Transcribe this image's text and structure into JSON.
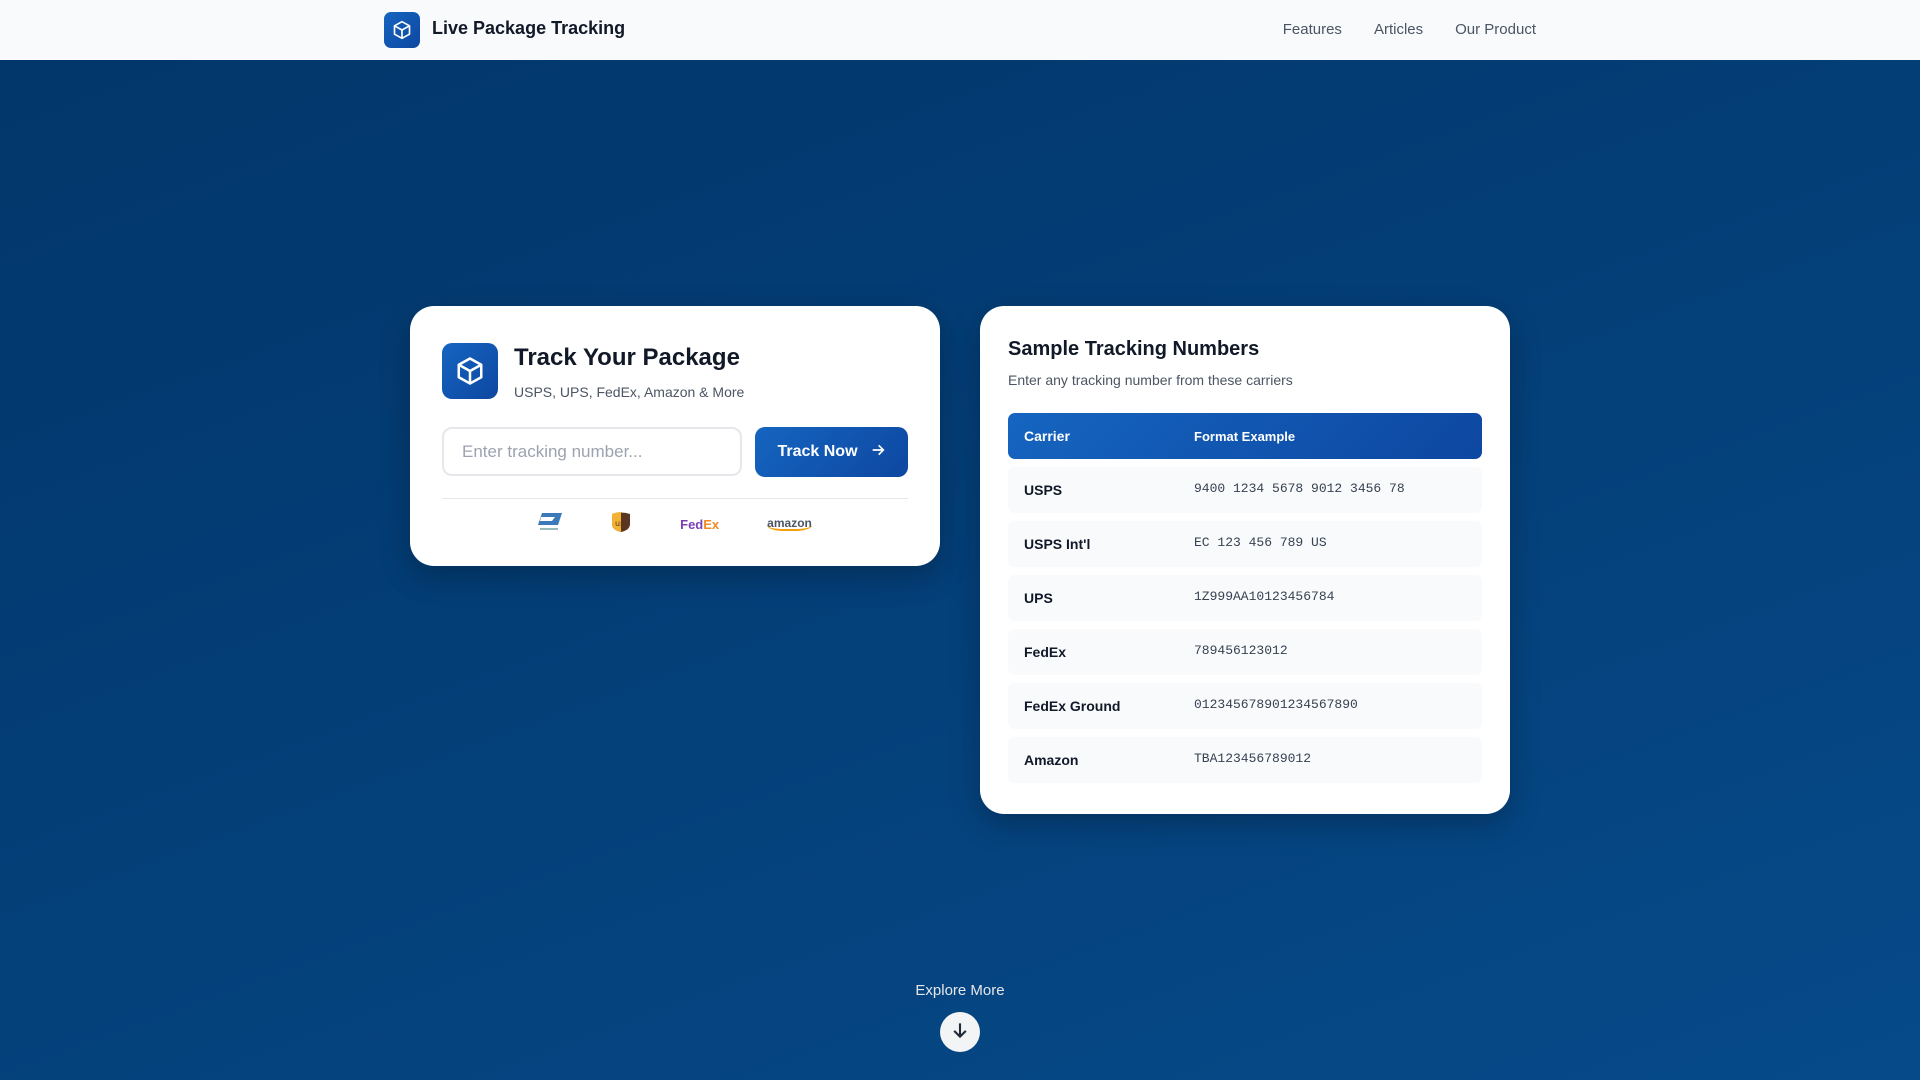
{
  "header": {
    "title": "Live Package Tracking",
    "nav": [
      "Features",
      "Articles",
      "Our Product"
    ]
  },
  "tracker": {
    "title": "Track Your Package",
    "subtitle": "USPS, UPS, FedEx, Amazon & More",
    "input_placeholder": "Enter tracking number...",
    "input_value": "",
    "button_label": "Track Now",
    "carriers": {
      "fedex_a": "Fed",
      "fedex_b": "Ex",
      "amazon": "amazon"
    },
    "colors": {
      "fedex_purple": "#7b3fb8",
      "fedex_orange": "#f08a24"
    }
  },
  "samples": {
    "title": "Sample Tracking Numbers",
    "subtitle": "Enter any tracking number from these carriers",
    "headers": [
      "Carrier",
      "Format Example"
    ],
    "rows": [
      [
        "USPS",
        "9400 1234 5678 9012 3456 78"
      ],
      [
        "USPS Int'l",
        "EC 123 456 789 US"
      ],
      [
        "UPS",
        "1Z999AA10123456784"
      ],
      [
        "FedEx",
        "789456123012"
      ],
      [
        "FedEx Ground",
        "012345678901234567890"
      ],
      [
        "Amazon",
        "TBA123456789012"
      ]
    ]
  },
  "explore": "Explore More",
  "colors": {
    "accent": "#1565c0",
    "bg": "#043f78"
  }
}
